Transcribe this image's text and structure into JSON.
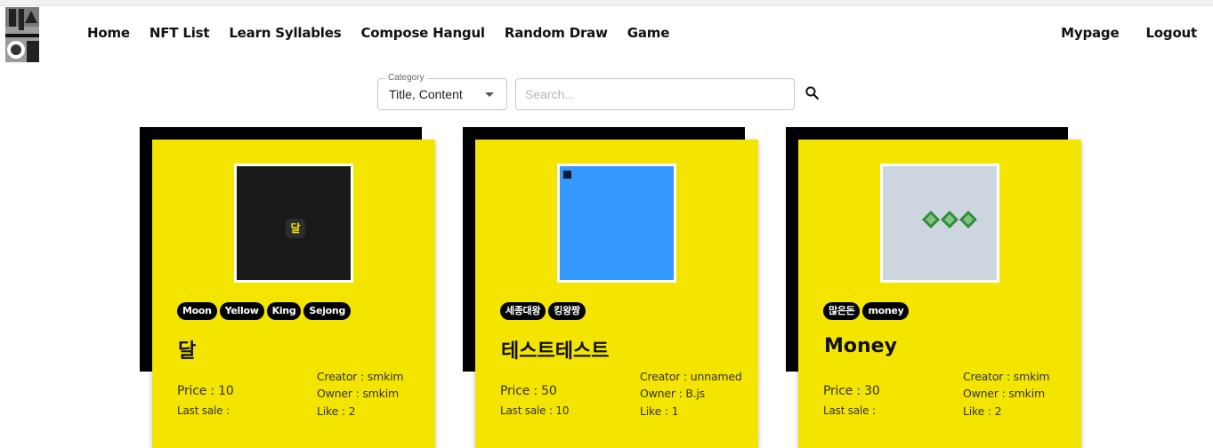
{
  "nav": {
    "items": [
      "Home",
      "NFT List",
      "Learn Syllables",
      "Compose Hangul",
      "Random Draw",
      "Game"
    ],
    "right": [
      "Mypage",
      "Logout"
    ]
  },
  "search": {
    "category_label": "Category",
    "category_value": "Title, Content",
    "placeholder": "Search..."
  },
  "cards": [
    {
      "tags": [
        "Moon",
        "Yellow",
        "King",
        "Sejong"
      ],
      "title": "달",
      "price": "Price : 10",
      "last_sale": "Last sale :",
      "creator": "Creator : smkim",
      "owner": "Owner : smkim",
      "like": "Like : 2",
      "thumb_bg": "#1a1a1a",
      "glyph": "달"
    },
    {
      "tags": [
        "세종대왕",
        "킹왕짱"
      ],
      "title": "테스트테스트",
      "price": "Price : 50",
      "last_sale": "Last sale : 10",
      "creator": "Creator : unnamed",
      "owner": "Owner : B.js",
      "like": "Like : 1",
      "thumb_bg": "#3399ff"
    },
    {
      "tags": [
        "많은돈",
        "money"
      ],
      "title": "Money",
      "price": "Price : 30",
      "last_sale": "Last sale :",
      "creator": "Creator : smkim",
      "owner": "Owner : smkim",
      "like": "Like : 2",
      "thumb_bg": "#cdd5df"
    }
  ],
  "colors": {
    "card": "#f4e500",
    "shadow": "#000000"
  }
}
